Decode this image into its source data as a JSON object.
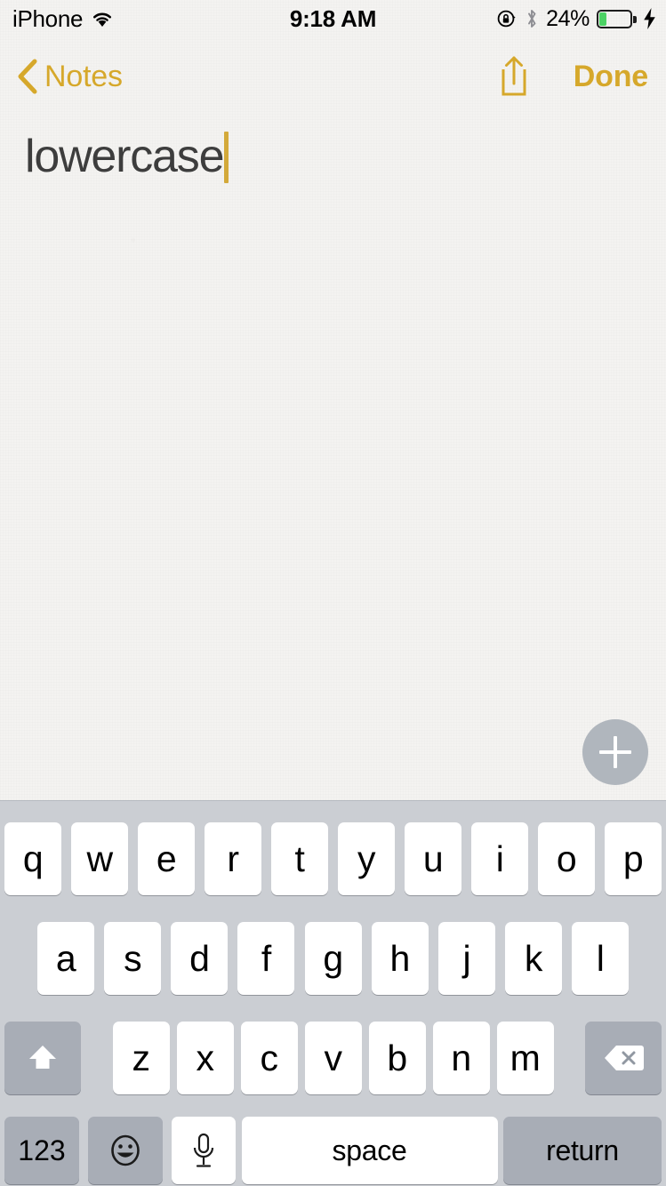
{
  "status_bar": {
    "carrier": "iPhone",
    "wifi_icon": "wifi-icon",
    "time": "9:18 AM",
    "rotation_lock_icon": "rotation-lock-icon",
    "bluetooth_icon": "bluetooth-icon",
    "battery_percent": "24%",
    "battery_level": 24,
    "charging_icon": "charging-bolt-icon",
    "battery_color": "#4cd264"
  },
  "nav_bar": {
    "back_icon": "chevron-left-icon",
    "back_label": "Notes",
    "share_icon": "share-icon",
    "done_label": "Done",
    "accent_color": "#d6a82b"
  },
  "note": {
    "text": "lowercase",
    "caret_color": "#d3a93a",
    "add_button_icon": "plus-icon"
  },
  "keyboard": {
    "row1": [
      "q",
      "w",
      "e",
      "r",
      "t",
      "y",
      "u",
      "i",
      "o",
      "p"
    ],
    "row2": [
      "a",
      "s",
      "d",
      "f",
      "g",
      "h",
      "j",
      "k",
      "l"
    ],
    "row3_letters": [
      "z",
      "x",
      "c",
      "v",
      "b",
      "n",
      "m"
    ],
    "shift_icon": "shift-up-arrow-icon",
    "backspace_icon": "backspace-delete-icon",
    "numbers_label": "123",
    "emoji_icon": "emoji-smiley-icon",
    "dictation_icon": "microphone-icon",
    "space_label": "space",
    "return_label": "return",
    "background_color": "#cbced3",
    "key_color": "#ffffff",
    "modifier_key_color": "#a8adb6"
  }
}
